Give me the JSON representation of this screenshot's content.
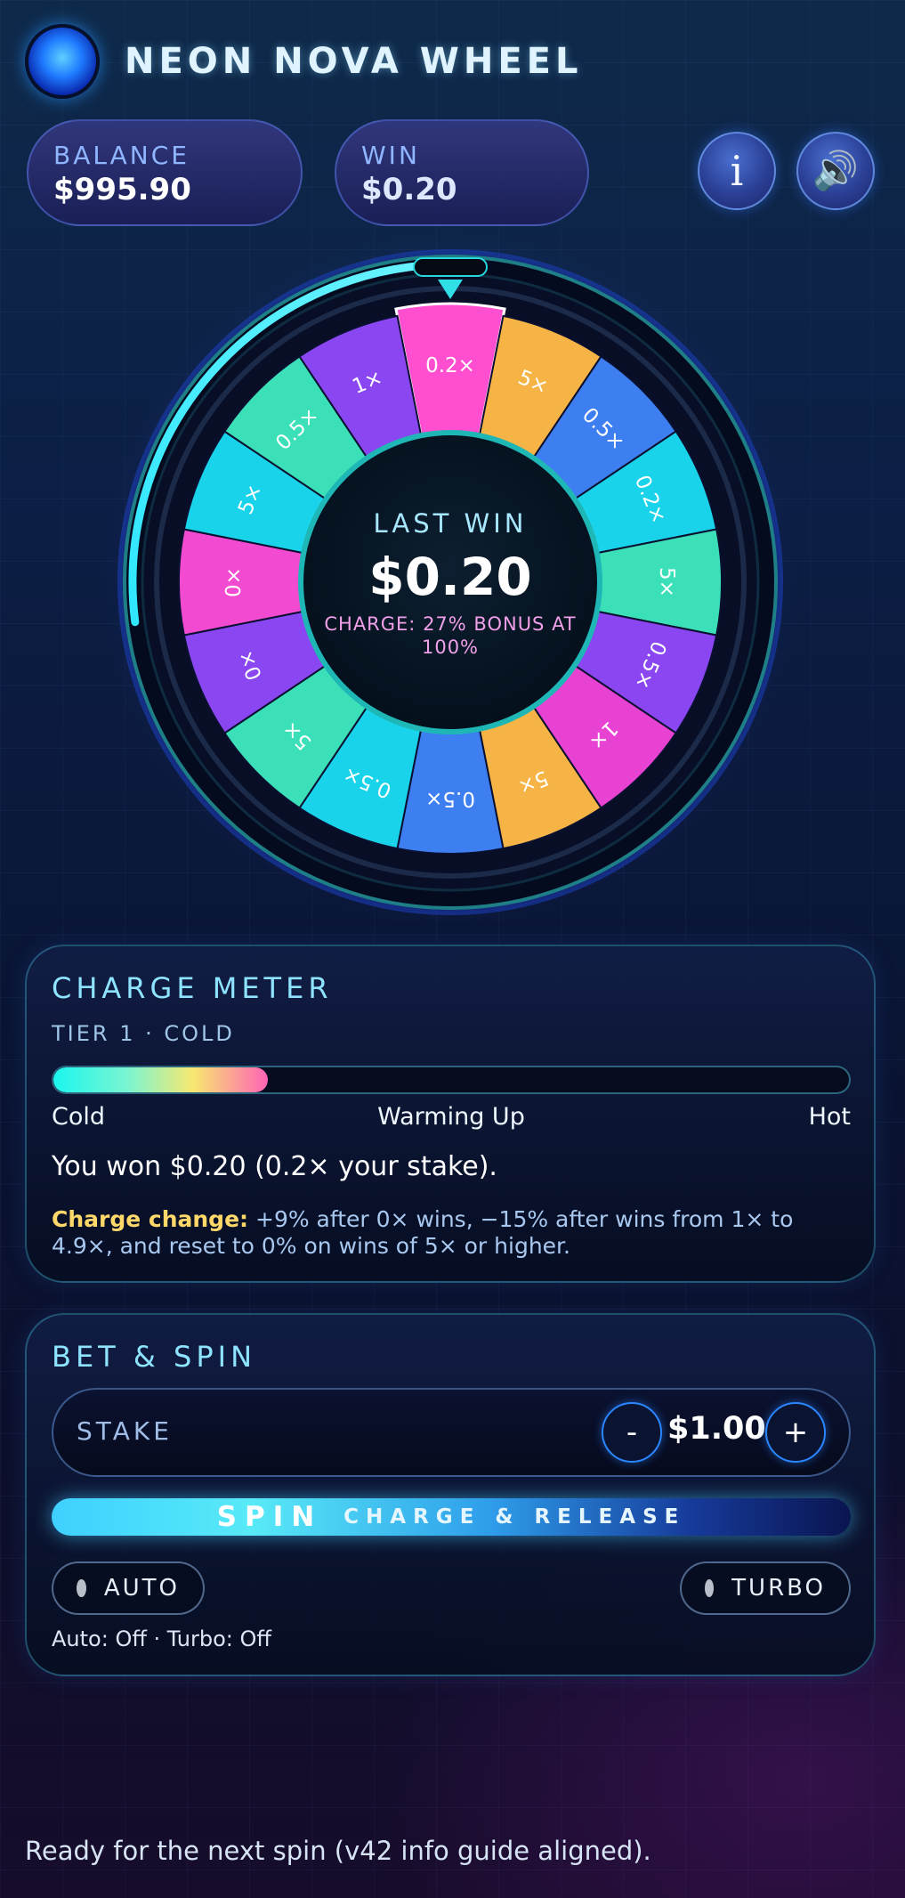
{
  "app": {
    "title": "NEON NOVA WHEEL"
  },
  "stats": {
    "balance_label": "BALANCE",
    "balance_value": "$995.90",
    "win_label": "WIN",
    "win_value": "$0.20"
  },
  "buttons": {
    "info_label": "i",
    "sound_icon": "speaker-icon"
  },
  "wheel": {
    "center_label": "LAST WIN",
    "center_value": "$0.20",
    "center_note": "CHARGE: 27% BONUS AT 100%",
    "charge_fraction": 0.27,
    "segments": [
      {
        "label": "0.2×",
        "color": "#ff4fd0",
        "highlight": true
      },
      {
        "label": "5×",
        "color": "#f5b445"
      },
      {
        "label": "0.5×",
        "color": "#3d7ff0"
      },
      {
        "label": "0.2×",
        "color": "#19d3ea"
      },
      {
        "label": "5×",
        "color": "#3ce0b8"
      },
      {
        "label": "0.5×",
        "color": "#8a46f0"
      },
      {
        "label": "1×",
        "color": "#e842d2"
      },
      {
        "label": "5×",
        "color": "#f5b445"
      },
      {
        "label": "0.5×",
        "color": "#3d7ff0"
      },
      {
        "label": "0.5×",
        "color": "#19d3ea"
      },
      {
        "label": "5×",
        "color": "#3ce0b8"
      },
      {
        "label": "0×",
        "color": "#8a46f0"
      },
      {
        "label": "0×",
        "color": "#f24bd2"
      },
      {
        "label": "5×",
        "color": "#19d3ea"
      },
      {
        "label": "0.5×",
        "color": "#3ce0b8"
      },
      {
        "label": "1×",
        "color": "#8a46f0"
      }
    ]
  },
  "charge": {
    "title": "CHARGE METER",
    "tier": "TIER 1 · COLD",
    "fill_fraction": 0.27,
    "scale_left": "Cold",
    "scale_mid": "Warming Up",
    "scale_right": "Hot",
    "win_message": "You won $0.20 (0.2× your stake).",
    "rule_label": "Charge change:",
    "rule_text": " +9% after 0× wins, −15% after wins from 1× to 4.9×, and reset to 0% on wins of 5× or higher."
  },
  "bet": {
    "title": "BET & SPIN",
    "stake_label": "STAKE",
    "stake_value": "$1.00",
    "minus_label": "-",
    "plus_label": "+",
    "spin_label": "SPIN",
    "spin_sub": "CHARGE & RELEASE",
    "auto_label": "AUTO",
    "turbo_label": "TURBO",
    "mode_status": "Auto: Off · Turbo: Off"
  },
  "footer": {
    "status": "Ready for the next spin (v42 info guide aligned)."
  },
  "colors": {
    "accent": "#1af6ee",
    "pink": "#ff4fd0",
    "gold": "#ffd86a"
  }
}
